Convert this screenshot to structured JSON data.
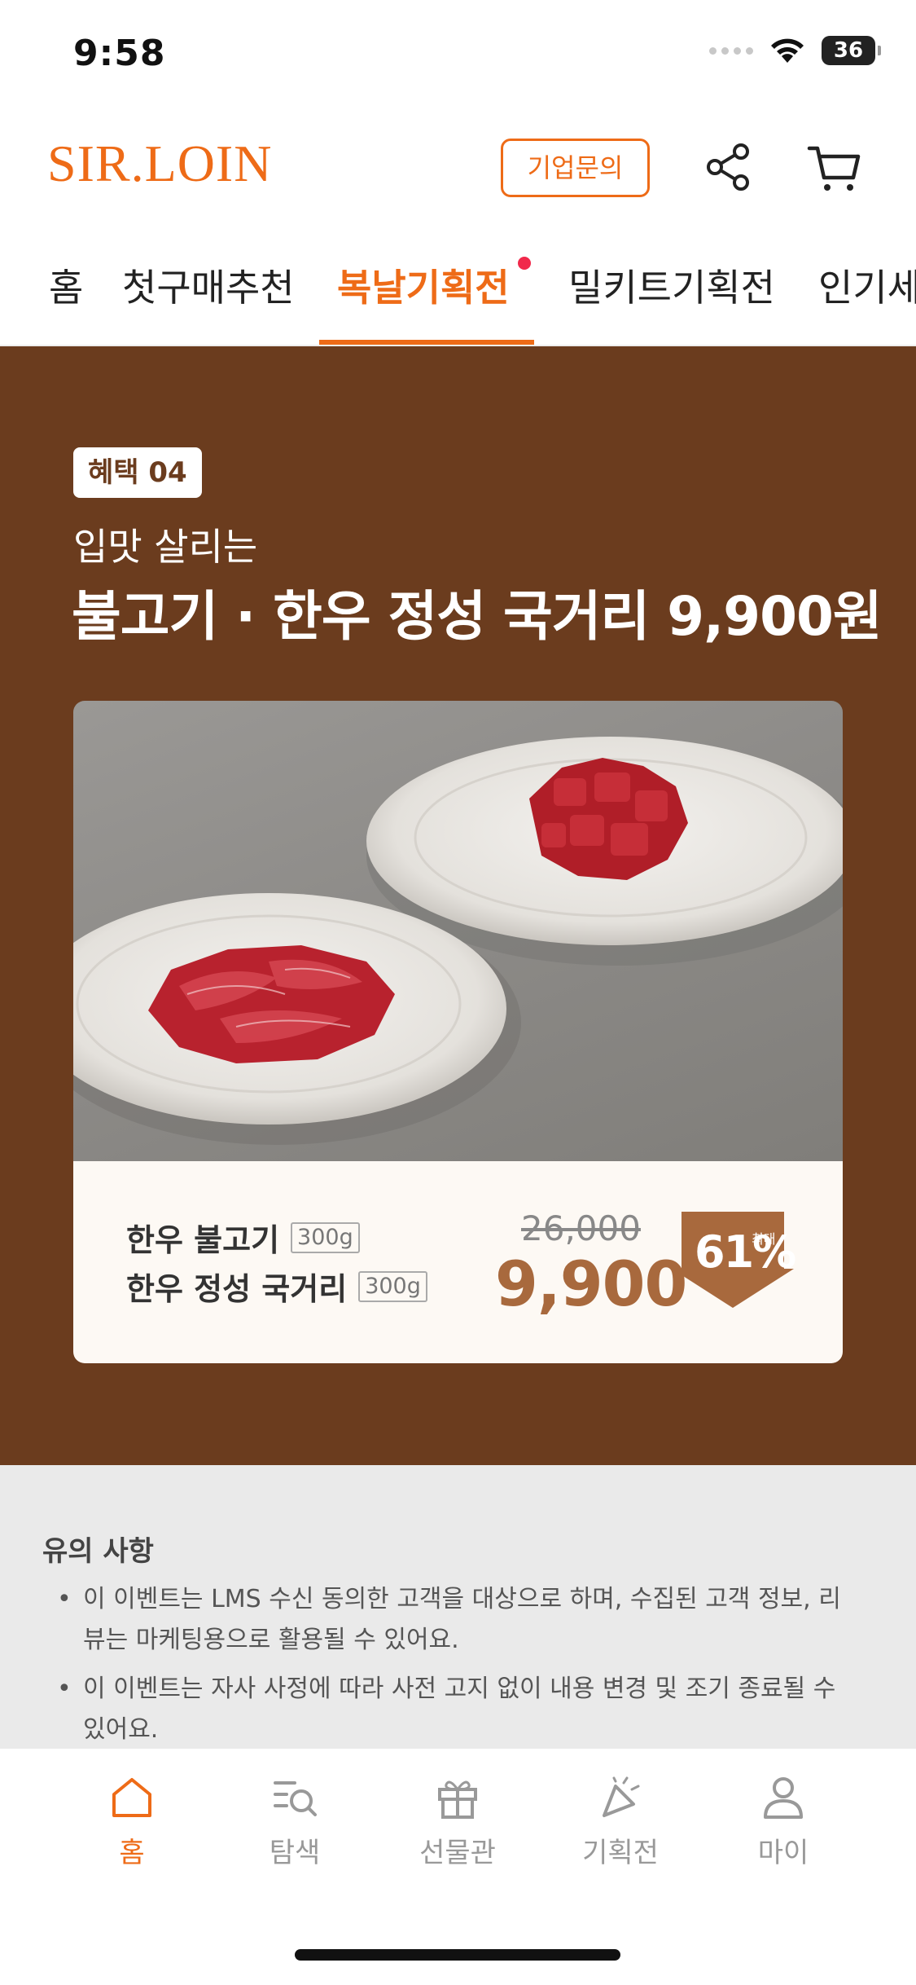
{
  "status_bar": {
    "time": "9:58",
    "battery": "36"
  },
  "header": {
    "logo": "SIR.LOIN",
    "inquiry_label": "기업문의"
  },
  "tabs": [
    {
      "label": "홈"
    },
    {
      "label": "첫구매추천"
    },
    {
      "label": "복날기획전"
    },
    {
      "label": "밀키트기획전"
    },
    {
      "label": "인기세"
    }
  ],
  "promo": {
    "badge": "혜택 04",
    "subtitle": "입맛 살리는",
    "title": "불고기 · 한우 정성 국거리 9,900원",
    "items": [
      {
        "name": "한우 불고기",
        "weight": "300g"
      },
      {
        "name": "한우 정성 국거리",
        "weight": "300g"
      }
    ],
    "original_price": "26,000",
    "sale_price": "9,900",
    "discount": "61%",
    "discount_max": "최대"
  },
  "notice": {
    "title": "유의 사항",
    "items": [
      "이 이벤트는 LMS 수신 동의한 고객을 대상으로 하며, 수집된 고객 정보, 리뷰는 마케팅용으로 활용될 수 있어요.",
      "이 이벤트는 자사 사정에 따라 사전 고지 없이 내용 변경 및 조기 종료될 수 있어요."
    ]
  },
  "bottom_nav": [
    {
      "label": "홈",
      "icon": "home-icon"
    },
    {
      "label": "탐색",
      "icon": "search-list-icon"
    },
    {
      "label": "선물관",
      "icon": "gift-icon"
    },
    {
      "label": "기획전",
      "icon": "party-icon"
    },
    {
      "label": "마이",
      "icon": "person-icon"
    }
  ],
  "colors": {
    "accent": "#ee6b17",
    "promo_bg": "#6b3c1e",
    "price": "#a8693d",
    "notice_bg": "#eaeaea"
  }
}
